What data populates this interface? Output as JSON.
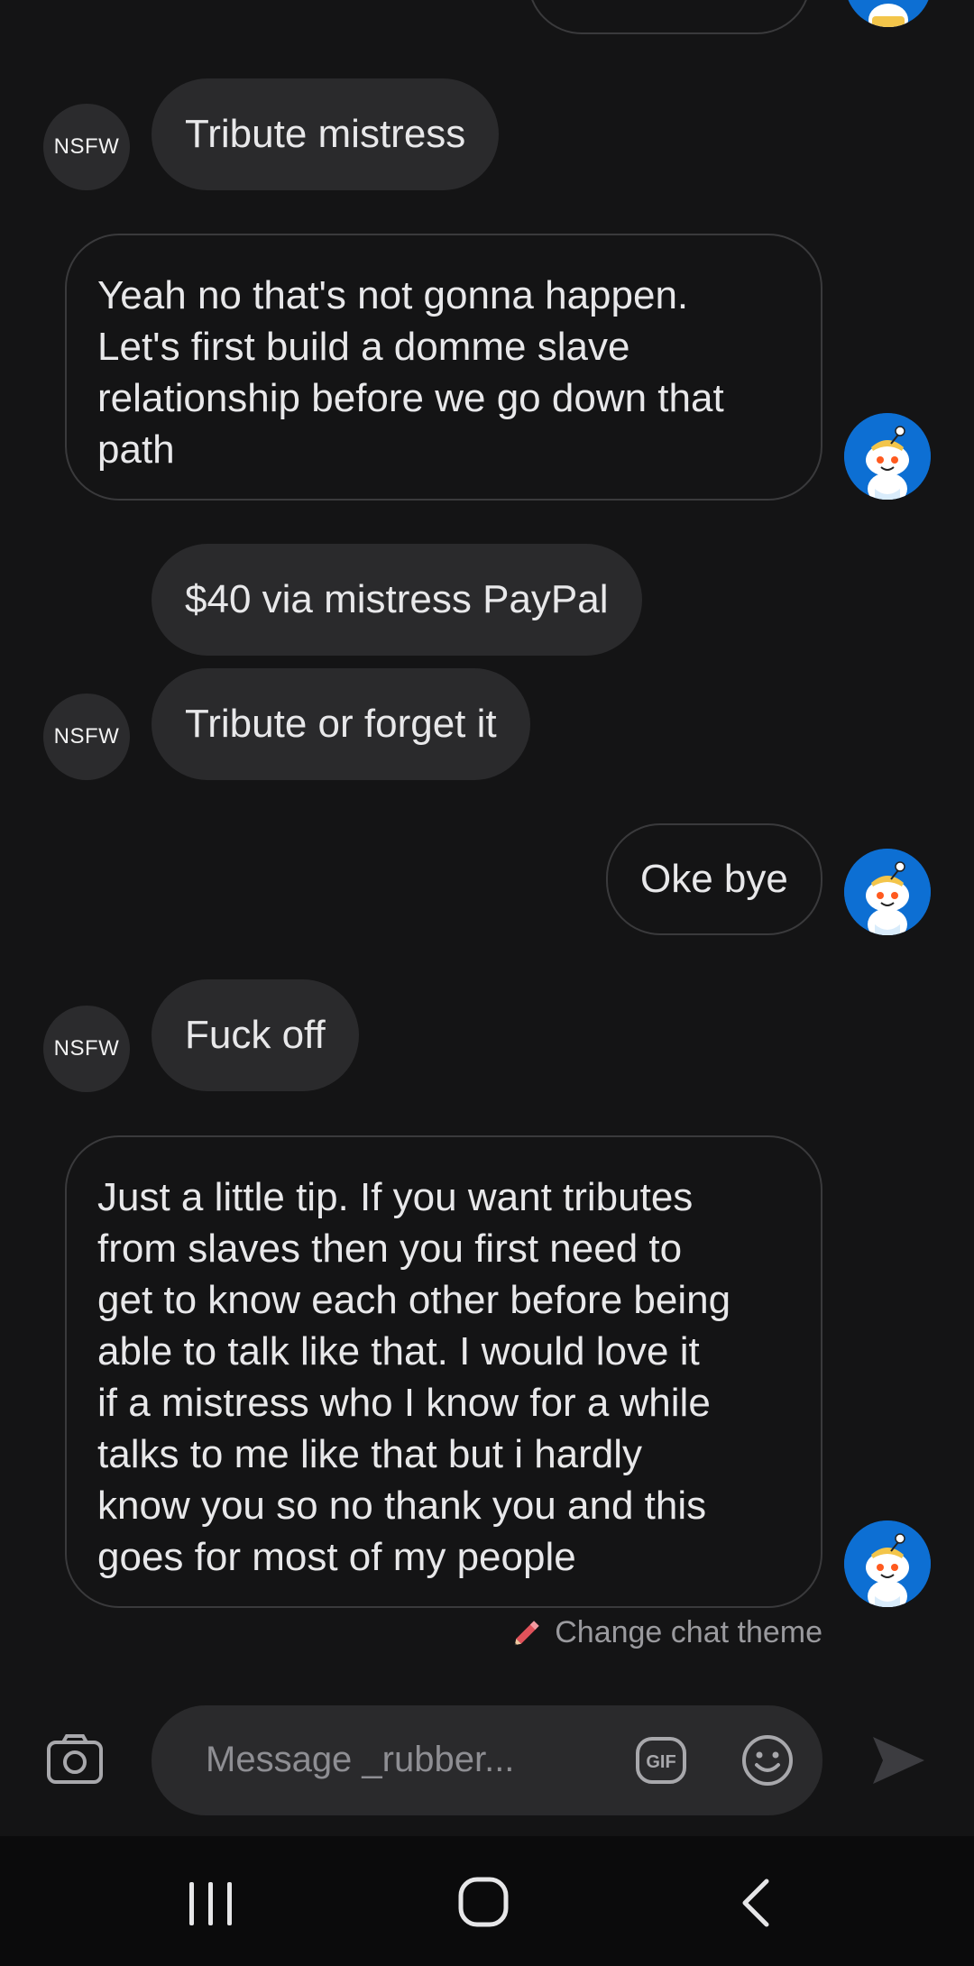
{
  "messages": [
    {
      "id": "m1",
      "direction": "incoming",
      "text": "Tribute mistress",
      "avatar": "NSFW"
    },
    {
      "id": "m2",
      "direction": "outgoing",
      "lines": [
        "Yeah no that's not gonna happen.",
        "Let's first build a domme slave",
        "relationship before we go down that",
        "path"
      ]
    },
    {
      "id": "m3",
      "direction": "incoming",
      "text": "$40 via mistress PayPal"
    },
    {
      "id": "m4",
      "direction": "incoming",
      "text": "Tribute or forget it",
      "avatar": "NSFW"
    },
    {
      "id": "m5",
      "direction": "outgoing",
      "text": "Oke bye"
    },
    {
      "id": "m6",
      "direction": "incoming",
      "text": "Fuck off",
      "avatar": "NSFW"
    },
    {
      "id": "m7",
      "direction": "outgoing",
      "lines": [
        "Just a little tip. If you want tributes",
        "from slaves then you first need to",
        "get to know each other before being",
        "able to talk like that. I would love it",
        "if a mistress who I know for a while",
        "talks to me like that but i hardly",
        "know you so no thank you and this",
        "goes for most of my people"
      ]
    }
  ],
  "avatars": {
    "incoming_label": "NSFW",
    "outgoing_icon": "snoo-avatar-icon"
  },
  "change_theme": {
    "label": "Change chat theme",
    "icon": "pencil-icon"
  },
  "composer": {
    "placeholder": "Message _rubber...",
    "camera_icon": "camera-icon",
    "gif_label": "GIF",
    "emoji_icon": "emoji-icon",
    "send_icon": "send-icon"
  },
  "navigation": {
    "recents_icon": "recents-icon",
    "home_icon": "home-icon",
    "back_icon": "back-icon"
  },
  "colors": {
    "background": "#141415",
    "bubble_incoming": "#2a2a2c",
    "bubble_outgoing_border": "#3a3a3c",
    "text": "#e8e8ea",
    "muted": "#9a9a9e",
    "snoo_blue": "#0d6fd3"
  }
}
